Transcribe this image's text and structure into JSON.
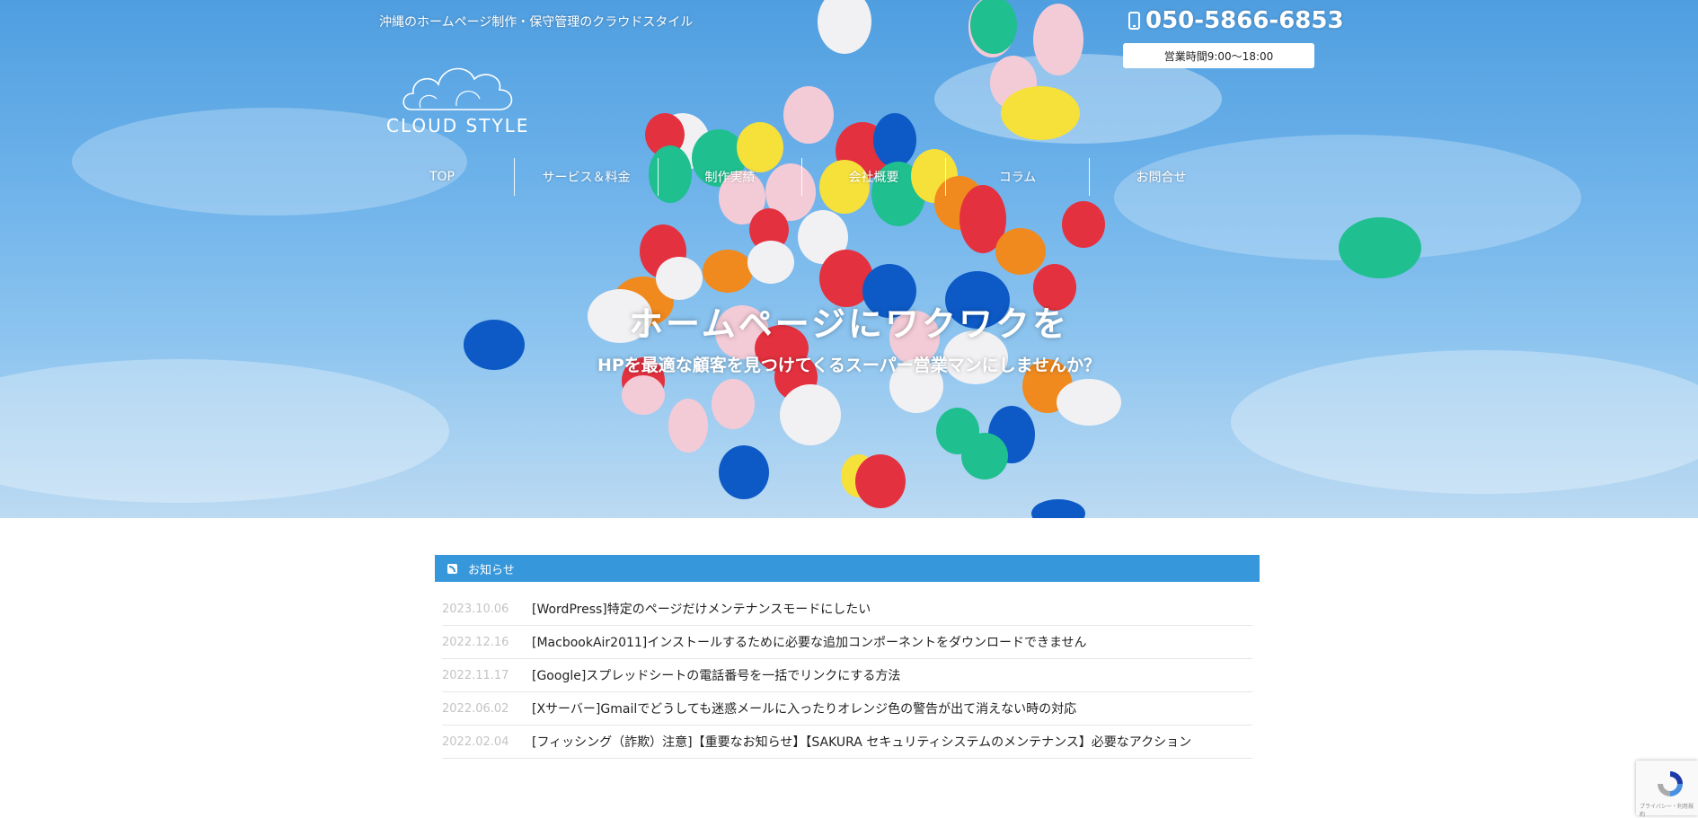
{
  "header": {
    "tagline": "沖縄のホームページ制作・保守管理のクラウドスタイル",
    "logo_text": "CLOUD STYLE",
    "phone": "050-5866-6853",
    "hours": "営業時間9:00〜18:00"
  },
  "nav": [
    {
      "label": "TOP"
    },
    {
      "label": "サービス＆料金"
    },
    {
      "label": "制作実績"
    },
    {
      "label": "会社概要"
    },
    {
      "label": "コラム"
    },
    {
      "label": "お問合せ"
    }
  ],
  "hero": {
    "title": "ホームページにワクワクを",
    "subtitle": "HPを最適な顧客を見つけてくるスーパー営業マンにしませんか？"
  },
  "news": {
    "heading": "お知らせ",
    "items": [
      {
        "date": "2023.10.06",
        "title": "[WordPress]特定のページだけメンテナンスモードにしたい"
      },
      {
        "date": "2022.12.16",
        "title": "[MacbookAir2011]インストールするために必要な追加コンポーネントをダウンロードできません"
      },
      {
        "date": "2022.11.17",
        "title": "[Google]スプレッドシートの電話番号を一括でリンクにする方法"
      },
      {
        "date": "2022.06.02",
        "title": "[Xサーバー]Gmailでどうしても迷惑メールに入ったりオレンジ色の警告が出て消えない時の対応"
      },
      {
        "date": "2022.02.04",
        "title": "[フィッシング（詐欺）注意]【重要なお知らせ】【SAKURA セキュリティシステムのメンテナンス】必要なアクション"
      }
    ]
  },
  "recaptcha": {
    "text": "プライバシー・利用規約"
  },
  "colors": {
    "accent": "#3797db",
    "sky": "#6db2ea"
  }
}
